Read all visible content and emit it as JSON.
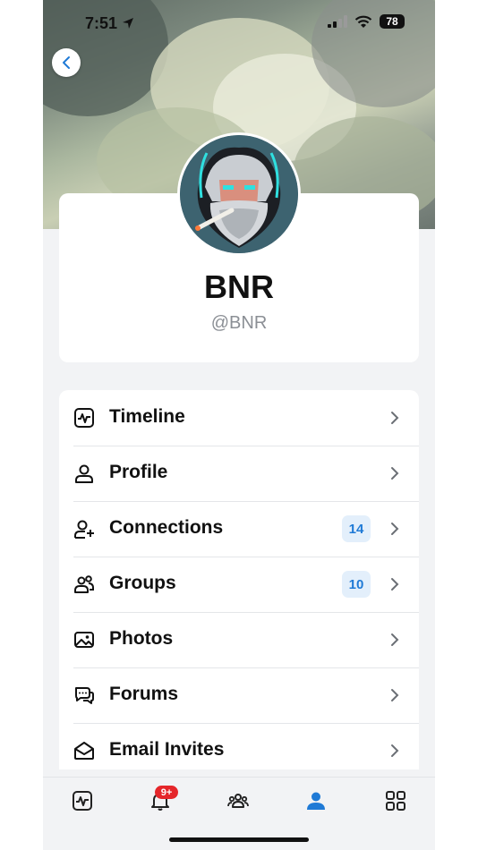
{
  "status_bar": {
    "time": "7:51",
    "battery": "78"
  },
  "profile": {
    "display_name": "BNR",
    "username": "@BNR"
  },
  "menu": {
    "items": [
      {
        "label": "Timeline",
        "icon": "activity-icon",
        "count": ""
      },
      {
        "label": "Profile",
        "icon": "user-icon",
        "count": ""
      },
      {
        "label": "Connections",
        "icon": "user-plus-icon",
        "count": "14"
      },
      {
        "label": "Groups",
        "icon": "users-icon",
        "count": "10"
      },
      {
        "label": "Photos",
        "icon": "image-icon",
        "count": ""
      },
      {
        "label": "Forums",
        "icon": "chat-bubbles-icon",
        "count": ""
      },
      {
        "label": "Email Invites",
        "icon": "envelope-open-icon",
        "count": ""
      }
    ]
  },
  "tab_bar": {
    "notifications_badge": "9+",
    "tabs": [
      "activity-tab-icon",
      "bell-tab-icon",
      "groups-tab-icon",
      "profile-tab-icon",
      "grid-tab-icon"
    ],
    "active_color": "#1f7ad6",
    "inactive_color": "#222222"
  },
  "colors": {
    "accent": "#1f7ad6",
    "badge_red": "#e5262a",
    "count_bg": "#e3effb"
  }
}
